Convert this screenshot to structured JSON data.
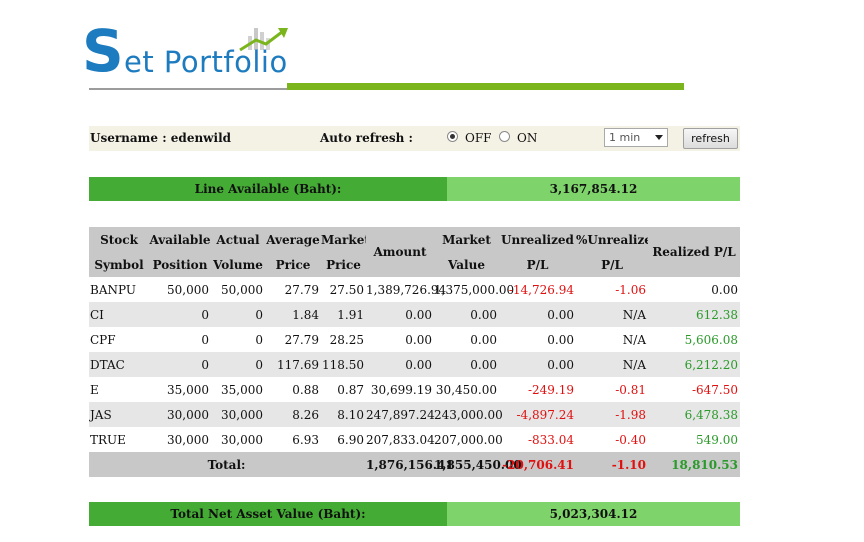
{
  "logo": {
    "big_letter": "S",
    "rest": "et Portfolio"
  },
  "controls": {
    "username_label": "Username : edenwild",
    "auto_refresh_label": "Auto refresh :",
    "off_label": "OFF",
    "on_label": "ON",
    "off_checked": true,
    "interval_value": "1 min",
    "refresh_label": "refresh"
  },
  "line_available": {
    "label": "Line Available (Baht):",
    "value": "3,167,854.12"
  },
  "table": {
    "headers": [
      [
        "Stock",
        "Symbol"
      ],
      [
        "Available",
        "Position"
      ],
      [
        "Actual",
        "Volume"
      ],
      [
        "Average",
        "Price"
      ],
      [
        "Market",
        "Price"
      ],
      [
        "Amount"
      ],
      [
        "Market",
        "Value"
      ],
      [
        "Unrealized",
        "P/L"
      ],
      [
        "%Unrealized",
        "P/L"
      ],
      [
        "Realized P/L"
      ]
    ],
    "rows": [
      [
        "BANPU",
        "50,000",
        "50,000",
        "27.79",
        "27.50",
        "1,389,726.94",
        "1,375,000.00",
        "-14,726.94",
        "-1.06",
        "0.00"
      ],
      [
        "CI",
        "0",
        "0",
        "1.84",
        "1.91",
        "0.00",
        "0.00",
        "0.00",
        "N/A",
        "612.38"
      ],
      [
        "CPF",
        "0",
        "0",
        "27.79",
        "28.25",
        "0.00",
        "0.00",
        "0.00",
        "N/A",
        "5,606.08"
      ],
      [
        "DTAC",
        "0",
        "0",
        "117.69",
        "118.50",
        "0.00",
        "0.00",
        "0.00",
        "N/A",
        "6,212.20"
      ],
      [
        "E",
        "35,000",
        "35,000",
        "0.88",
        "0.87",
        "30,699.19",
        "30,450.00",
        "-249.19",
        "-0.81",
        "-647.50"
      ],
      [
        "JAS",
        "30,000",
        "30,000",
        "8.26",
        "8.10",
        "247,897.24",
        "243,000.00",
        "-4,897.24",
        "-1.98",
        "6,478.38"
      ],
      [
        "TRUE",
        "30,000",
        "30,000",
        "6.93",
        "6.90",
        "207,833.04",
        "207,000.00",
        "-833.04",
        "-0.40",
        "549.00"
      ]
    ],
    "total": {
      "label": "Total:",
      "amount": "1,876,156.41",
      "market_value": "1,855,450.00",
      "unrealized_pl": "-20,706.41",
      "pct_unrealized_pl": "-1.10",
      "realized_pl": "18,810.53"
    }
  },
  "total_nav": {
    "label": "Total Net Asset Value (Baht):",
    "value": "5,023,304.12"
  },
  "colors": {
    "brand_blue": "#1d7bbf",
    "accent_green": "#7ab51d",
    "label_green": "#44ac34",
    "value_green": "#7fd36b",
    "negative": "#e01010",
    "positive": "#2a9a2a"
  }
}
